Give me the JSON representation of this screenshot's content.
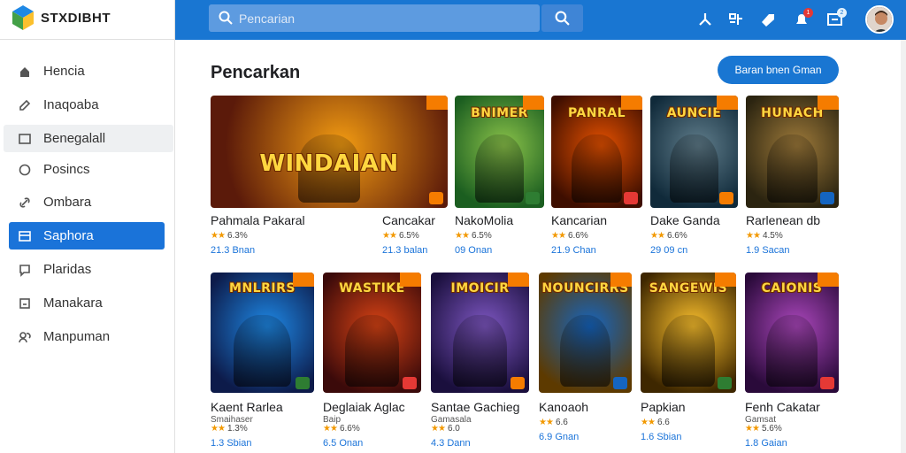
{
  "app": {
    "name": "STXDIBHT"
  },
  "search": {
    "placeholder": "Pencarian"
  },
  "topbar": {
    "icons": [
      "nodes-icon",
      "grid-icon",
      "tag-icon",
      "bell-icon",
      "inbox-icon"
    ],
    "badges": {
      "bell": "1",
      "inbox": "2"
    }
  },
  "sidebar": {
    "items": [
      {
        "label": "Hencia",
        "icon": "home-icon",
        "state": "normal"
      },
      {
        "label": "Inaqoaba",
        "icon": "edit-icon",
        "state": "normal"
      },
      {
        "label": "Benegalall",
        "icon": "folder-icon",
        "state": "hover"
      },
      {
        "label": "Posincs",
        "icon": "circle-icon",
        "state": "normal"
      },
      {
        "label": "Ombara",
        "icon": "link-icon",
        "state": "normal"
      },
      {
        "label": "Saphora",
        "icon": "store-icon",
        "state": "active"
      },
      {
        "label": "Plaridas",
        "icon": "chat-icon",
        "state": "normal"
      },
      {
        "label": "Manakara",
        "icon": "square-icon",
        "state": "normal"
      },
      {
        "label": "Manpuman",
        "icon": "users-icon",
        "state": "normal"
      }
    ]
  },
  "main": {
    "title": "Pencarkan",
    "primary_button": "Baran bnen Gman"
  },
  "games": [
    {
      "name": "Pahmala Pakaral",
      "sub": "",
      "rating": "6.3%",
      "size": "21.3 Bnan",
      "thumb_text": "WINDAIAN",
      "colors": [
        "#f39c12",
        "#5b1a0a"
      ]
    },
    {
      "name": "Cancakar",
      "sub": "",
      "rating": "6.5%",
      "size": "21.3 balan",
      "thumb_text": "",
      "colors": [
        "#f7b733",
        "#2a1a4a"
      ]
    },
    {
      "name": "NakoMolia",
      "sub": "",
      "rating": "6.5%",
      "size": "09 Onan",
      "thumb_text": "BNIMER",
      "colors": [
        "#8bc34a",
        "#1b5e20"
      ]
    },
    {
      "name": "Kancarian",
      "sub": "",
      "rating": "6.6%",
      "size": "21.9 Chan",
      "thumb_text": "PANRAL",
      "colors": [
        "#e65100",
        "#3e0e00"
      ]
    },
    {
      "name": "Dake Ganda",
      "sub": "",
      "rating": "6.6%",
      "size": "29 09 cn",
      "thumb_text": "AUNCIE",
      "colors": [
        "#607d8b",
        "#102a3a"
      ]
    },
    {
      "name": "Rarlenean db",
      "sub": "",
      "rating": "4.5%",
      "size": "1.9 Sacan",
      "thumb_text": "HUNACH",
      "colors": [
        "#9e7a3a",
        "#2b2410"
      ]
    },
    {
      "name": "Kaent Rarlea",
      "sub": "Smaihaser",
      "rating": "1.3%",
      "size": "1.3 Sbian",
      "thumb_text": "MNLRIRS",
      "colors": [
        "#1e88e5",
        "#0d1b4a"
      ]
    },
    {
      "name": "Deglaiak Aglac",
      "sub": "Baip",
      "rating": "6.6%",
      "size": "6.5 Onan",
      "thumb_text": "WASTIKE",
      "colors": [
        "#d84315",
        "#3b0a0a"
      ]
    },
    {
      "name": "Santae Gachieg",
      "sub": "Gamasala",
      "rating": "6.0",
      "size": "4.3 Dann",
      "thumb_text": "IMOICIR",
      "colors": [
        "#7e57c2",
        "#1a0f3d"
      ]
    },
    {
      "name": "Kanoaoh",
      "sub": "",
      "rating": "6.6",
      "size": "6.9 Gnan",
      "thumb_text": "NOUNCIRRS",
      "colors": [
        "#1565c0",
        "#5d3a00"
      ]
    },
    {
      "name": "Papkian",
      "sub": "",
      "rating": "6.6",
      "size": "1.6 Sbian",
      "thumb_text": "SANGEWIS",
      "colors": [
        "#fbc02d",
        "#3e2700"
      ]
    },
    {
      "name": "Fenh Cakatar",
      "sub": "Gamsat",
      "rating": "5.6%",
      "size": "1.8 Gaian",
      "thumb_text": "CAIONIS",
      "colors": [
        "#ab47bc",
        "#2a0a3a"
      ]
    }
  ]
}
